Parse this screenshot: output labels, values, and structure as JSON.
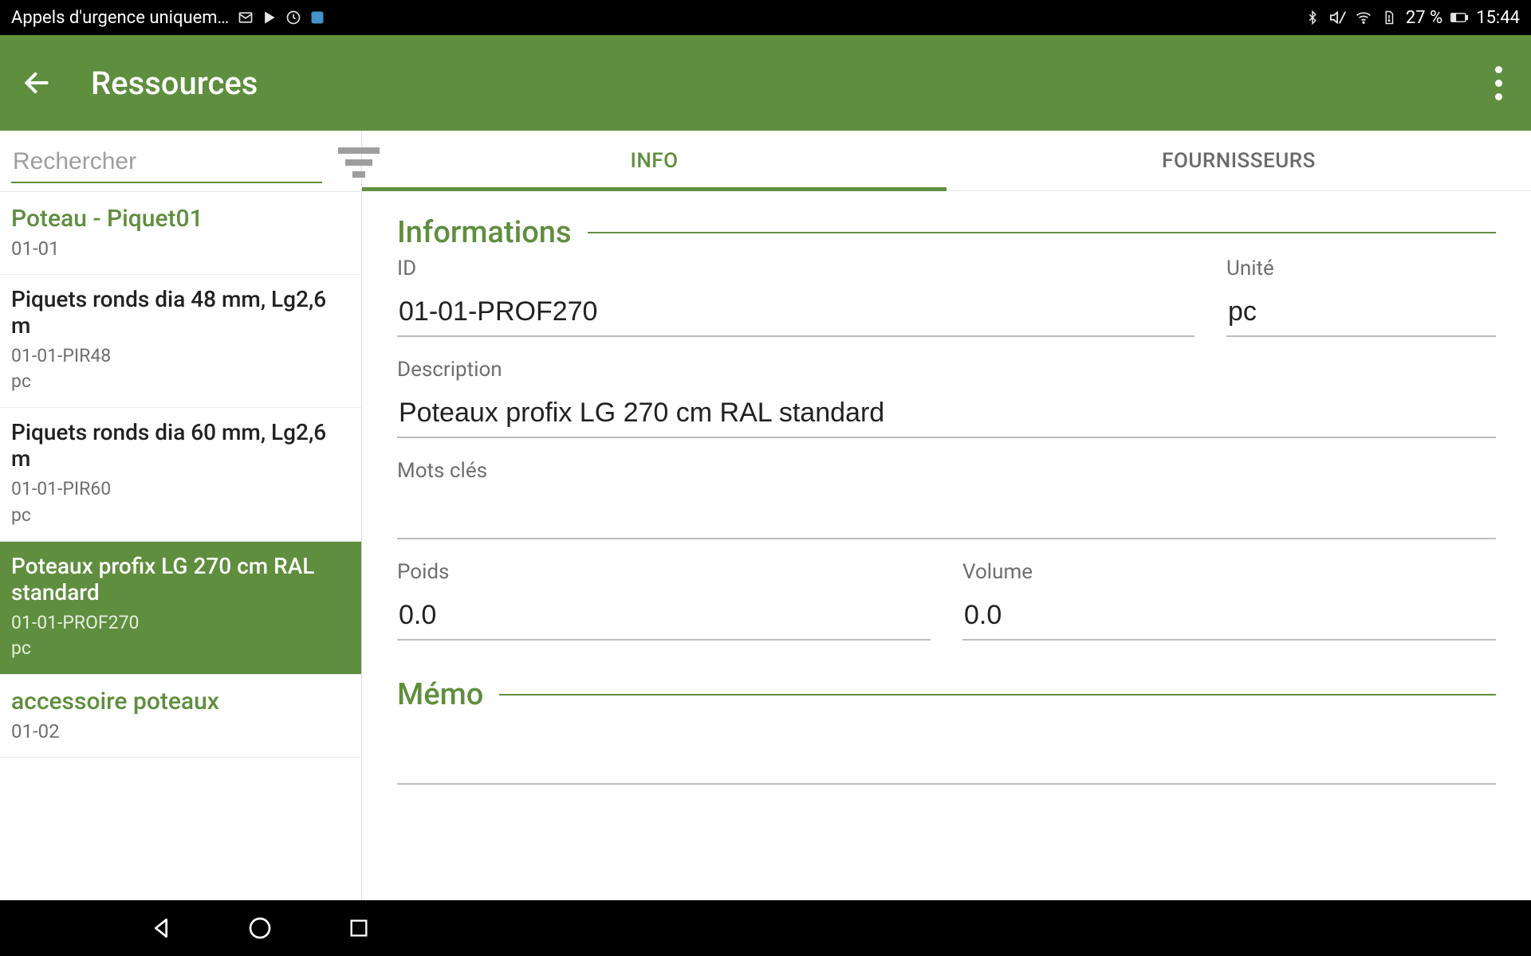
{
  "status": {
    "left_text": "Appels d'urgence uniquem…",
    "battery_text": "27 %",
    "time": "15:44"
  },
  "appbar": {
    "title": "Ressources"
  },
  "search": {
    "placeholder": "Rechercher",
    "value": ""
  },
  "list": [
    {
      "type": "category",
      "title": "Poteau - Piquet01",
      "sub": "01-01"
    },
    {
      "type": "item",
      "title": "Piquets ronds dia 48 mm, Lg2,6 m",
      "code": "01-01-PIR48",
      "unit": "pc",
      "selected": false
    },
    {
      "type": "item",
      "title": "Piquets ronds dia 60 mm, Lg2,6 m",
      "code": "01-01-PIR60",
      "unit": "pc",
      "selected": false
    },
    {
      "type": "item",
      "title": "Poteaux profix LG 270 cm RAL standard",
      "code": "01-01-PROF270",
      "unit": "pc",
      "selected": true
    },
    {
      "type": "category",
      "title": "accessoire poteaux",
      "sub": "01-02"
    }
  ],
  "tabs": {
    "info": "INFO",
    "fournisseurs": "FOURNISSEURS",
    "active": "info"
  },
  "detail": {
    "section_informations": "Informations",
    "section_memo": "Mémo",
    "labels": {
      "id": "ID",
      "unite": "Unité",
      "description": "Description",
      "mots_cles": "Mots clés",
      "poids": "Poids",
      "volume": "Volume"
    },
    "values": {
      "id": "01-01-PROF270",
      "unite": "pc",
      "description": "Poteaux profix LG 270 cm RAL standard",
      "mots_cles": "",
      "poids": "0.0",
      "volume": "0.0",
      "memo": ""
    }
  },
  "colors": {
    "primary": "#5f8e3e"
  }
}
